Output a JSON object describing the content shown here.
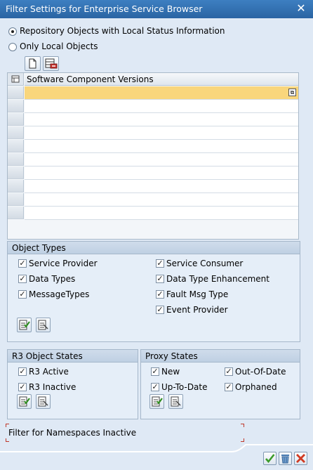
{
  "window": {
    "title": "Filter Settings for Enterprise Service Browser",
    "close_glyph": "✕"
  },
  "scope": {
    "option1": "Repository Objects with Local Status Information",
    "option2": "Only Local Objects",
    "selected": "option1"
  },
  "table": {
    "header": "Software Component Versions",
    "rows": [
      "",
      "",
      "",
      "",
      "",
      "",
      "",
      "",
      "",
      ""
    ]
  },
  "object_types": {
    "title": "Object Types",
    "left": [
      {
        "label": "Service Provider",
        "checked": true
      },
      {
        "label": "Data Types",
        "checked": true
      },
      {
        "label": "MessageTypes",
        "checked": true
      }
    ],
    "right": [
      {
        "label": "Service Consumer",
        "checked": true
      },
      {
        "label": "Data Type Enhancement",
        "checked": true
      },
      {
        "label": "Fault Msg Type",
        "checked": true
      },
      {
        "label": "Event Provider",
        "checked": true
      }
    ]
  },
  "r3_states": {
    "title": "R3 Object States",
    "items": [
      {
        "label": "R3 Active",
        "checked": true
      },
      {
        "label": "R3 Inactive",
        "checked": true
      }
    ]
  },
  "proxy_states": {
    "title": "Proxy States",
    "items": [
      {
        "label": "New",
        "checked": true
      },
      {
        "label": "Out-Of-Date",
        "checked": true
      },
      {
        "label": "Up-To-Date",
        "checked": true
      },
      {
        "label": "Orphaned",
        "checked": true
      }
    ]
  },
  "info_message": "Filter for Namespaces Inactive",
  "icons": {
    "close": "close-icon",
    "new_row": "document-new-icon",
    "delete_row": "row-delete-icon",
    "value_help": "value-help-icon",
    "select_all": "select-all-icon",
    "deselect_all": "deselect-all-icon",
    "ok": "checkmark-icon",
    "trash": "trash-icon",
    "cancel": "cancel-icon"
  },
  "colors": {
    "title_bar": "#2f6fb2",
    "selected_row": "#f9d67c",
    "ok": "#3a9b2a",
    "cancel": "#d03a22"
  }
}
